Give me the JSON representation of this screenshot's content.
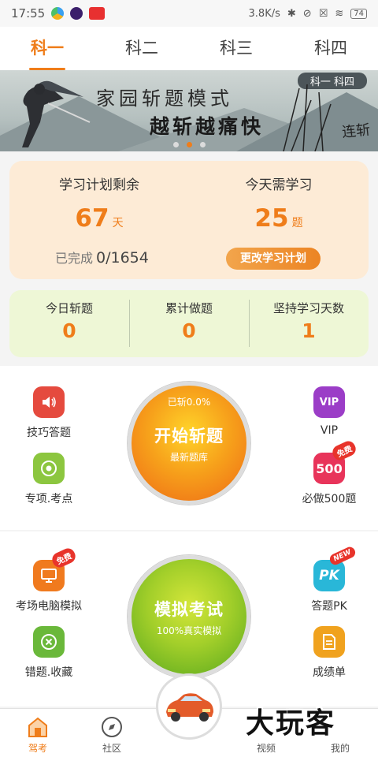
{
  "status": {
    "time": "17:55",
    "speed": "3.8K/s",
    "battery": "74"
  },
  "tabs": [
    {
      "label": "科一",
      "active": true
    },
    {
      "label": "科二",
      "active": false
    },
    {
      "label": "科三",
      "active": false
    },
    {
      "label": "科四",
      "active": false
    }
  ],
  "banner": {
    "tag": "科一 科四",
    "line1": "家园斩题模式",
    "line2": "越斩越痛快",
    "brush": "连斩",
    "dots_active": 1
  },
  "plan": {
    "remain_label": "学习计划剩余",
    "remain_value": "67",
    "remain_unit": "天",
    "today_label": "今天需学习",
    "today_value": "25",
    "today_unit": "题",
    "done_label": "已完成",
    "done_value": "0/1654",
    "change_button": "更改学习计划"
  },
  "stats": [
    {
      "label": "今日斩题",
      "value": "0"
    },
    {
      "label": "累计做题",
      "value": "0"
    },
    {
      "label": "坚持学习天数",
      "value": "1"
    }
  ],
  "practice": {
    "left": [
      {
        "label": "技巧答题",
        "icon": "speaker-icon",
        "color": "#e54a3e"
      },
      {
        "label": "专项.考点",
        "icon": "target-icon",
        "color": "#8cc63f"
      }
    ],
    "right": [
      {
        "label": "VIP",
        "icon": "vip-icon",
        "color": "#9b3dc7"
      },
      {
        "label": "必做500题",
        "icon": "500-icon",
        "color": "#e8345a",
        "badge": "免费"
      }
    ],
    "ball": {
      "progress": "已斩0.0%",
      "title": "开始斩题",
      "subtitle": "最新题库"
    }
  },
  "exam": {
    "left": [
      {
        "label": "考场电脑模拟",
        "icon": "monitor-icon",
        "color": "#f07a1e",
        "badge": "免费"
      },
      {
        "label": "错题.收藏",
        "icon": "close-circle-icon",
        "color": "#6ab83a"
      }
    ],
    "right": [
      {
        "label": "答题PK",
        "icon": "pk-icon",
        "color": "#29b7d8",
        "badge": "NEW"
      },
      {
        "label": "成绩单",
        "icon": "report-icon",
        "color": "#f0a21e"
      }
    ],
    "ball": {
      "title": "模拟考试",
      "subtitle": "100%真实模拟"
    }
  },
  "bottom_nav": [
    {
      "label": "驾考",
      "icon": "home-icon",
      "active": true
    },
    {
      "label": "社区",
      "icon": "compass-icon",
      "active": false
    },
    {
      "label": "视频",
      "icon": "video-icon",
      "active": false
    },
    {
      "label": "我的",
      "icon": "user-icon",
      "active": false
    }
  ],
  "watermark": "大玩客",
  "colors": {
    "accent": "#ef7d1a",
    "plan_bg": "#fdebd6",
    "stats_bg": "#eef7d6"
  }
}
